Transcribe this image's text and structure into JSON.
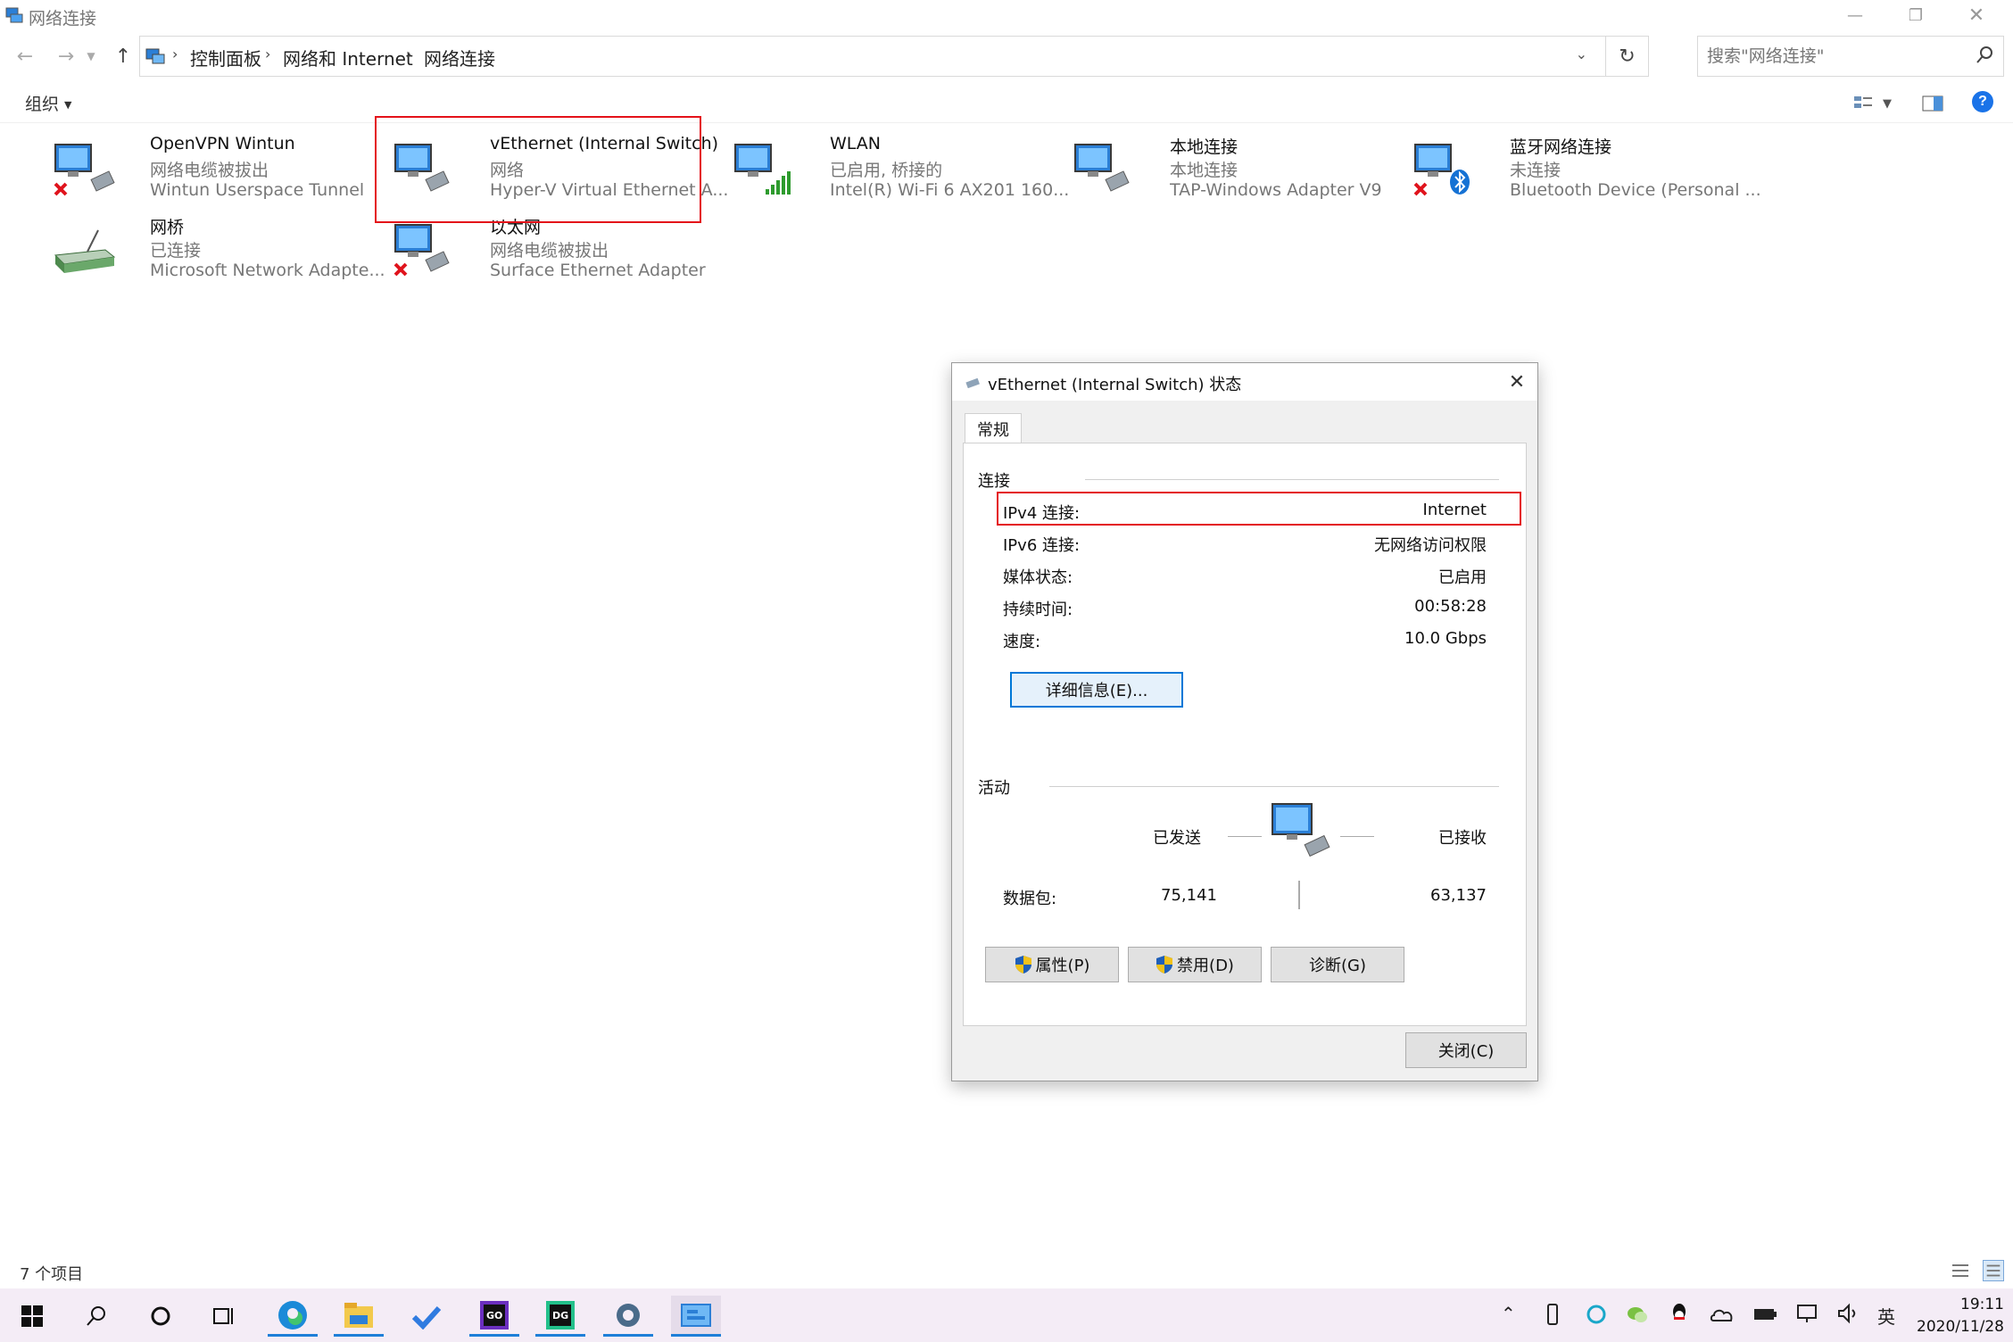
{
  "window": {
    "title": "网络连接",
    "breadcrumb": [
      "控制面板",
      "网络和 Internet",
      "网络连接"
    ],
    "search_placeholder": "搜索\"网络连接\"",
    "organize_label": "组织",
    "status_count": "7 个项目"
  },
  "connections": [
    {
      "name": "OpenVPN Wintun",
      "status": "网络电缆被拔出",
      "device": "Wintun Userspace Tunnel",
      "icon": "network-adapter-disconnected-icon"
    },
    {
      "name": "vEthernet (Internal Switch)",
      "status": "网络",
      "device": "Hyper-V Virtual Ethernet A...",
      "icon": "network-adapter-icon"
    },
    {
      "name": "WLAN",
      "status": "已启用, 桥接的",
      "device": "Intel(R) Wi-Fi 6 AX201 160...",
      "icon": "wifi-adapter-icon"
    },
    {
      "name": "本地连接",
      "status": "本地连接",
      "device": "TAP-Windows Adapter V9",
      "icon": "network-adapter-icon"
    },
    {
      "name": "蓝牙网络连接",
      "status": "未连接",
      "device": "Bluetooth Device (Personal ...",
      "icon": "bluetooth-adapter-icon"
    },
    {
      "name": "网桥",
      "status": "已连接",
      "device": "Microsoft Network Adapte...",
      "icon": "network-bridge-icon"
    },
    {
      "name": "以太网",
      "status": "网络电缆被拔出",
      "device": "Surface Ethernet Adapter",
      "icon": "network-adapter-disconnected-icon"
    }
  ],
  "dialog": {
    "title": "vEthernet (Internal Switch) 状态",
    "tab": "常规",
    "connection_group": "连接",
    "rows": [
      {
        "label": "IPv4 连接:",
        "value": "Internet"
      },
      {
        "label": "IPv6 连接:",
        "value": "无网络访问权限"
      },
      {
        "label": "媒体状态:",
        "value": "已启用"
      },
      {
        "label": "持续时间:",
        "value": "00:58:28"
      },
      {
        "label": "速度:",
        "value": "10.0 Gbps"
      }
    ],
    "details_button": "详细信息(E)...",
    "activity_group": "活动",
    "sent_label": "已发送",
    "received_label": "已接收",
    "packets_label": "数据包:",
    "packets_sent": "75,141",
    "packets_received": "63,137",
    "properties_button": "属性(P)",
    "disable_button": "禁用(D)",
    "diagnose_button": "诊断(G)",
    "close_button": "关闭(C)"
  },
  "taskbar": {
    "ime": "英",
    "time": "19:11",
    "date": "2020/11/28"
  },
  "colors": {
    "highlight": "#e4121a",
    "taskbar_bg": "#f4ecf6",
    "accent": "#0078d7"
  }
}
